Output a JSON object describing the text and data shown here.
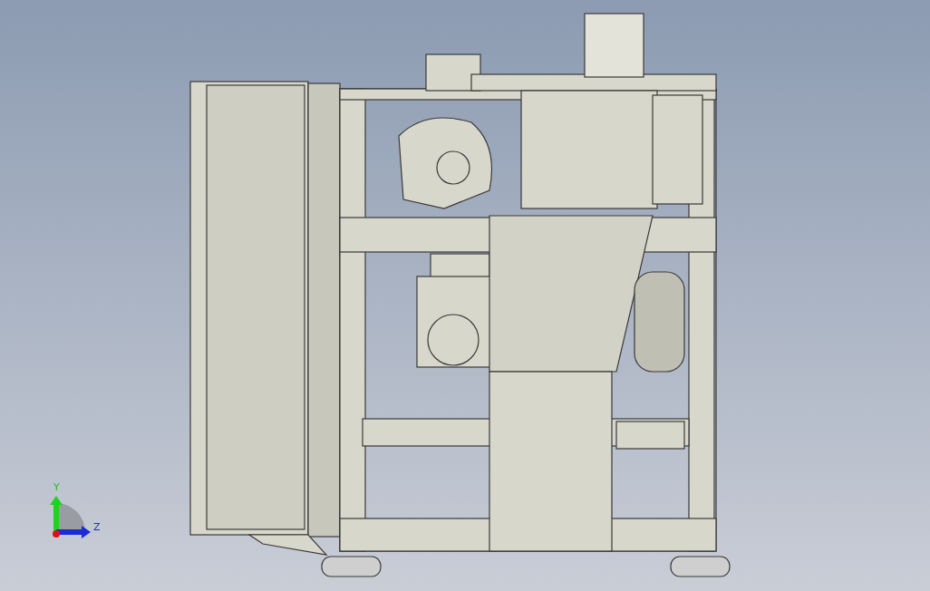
{
  "triad": {
    "y_label": "Y",
    "z_label": "Z"
  }
}
